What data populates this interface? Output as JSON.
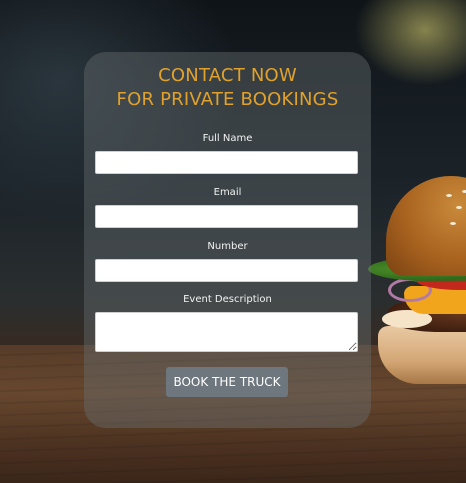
{
  "form": {
    "title_line1": "CONTACT NOW",
    "title_line2": "FOR PRIVATE BOOKINGS",
    "fields": {
      "full_name": {
        "label": "Full Name",
        "value": ""
      },
      "email": {
        "label": "Email",
        "value": ""
      },
      "number": {
        "label": "Number",
        "value": ""
      },
      "event_description": {
        "label": "Event Description",
        "value": ""
      }
    },
    "submit_label": "BOOK THE TRUCK"
  },
  "colors": {
    "title_accent": "#e0a22c",
    "button_background": "#6e767e",
    "card_overlay": "rgba(105,112,115,0.42)"
  }
}
